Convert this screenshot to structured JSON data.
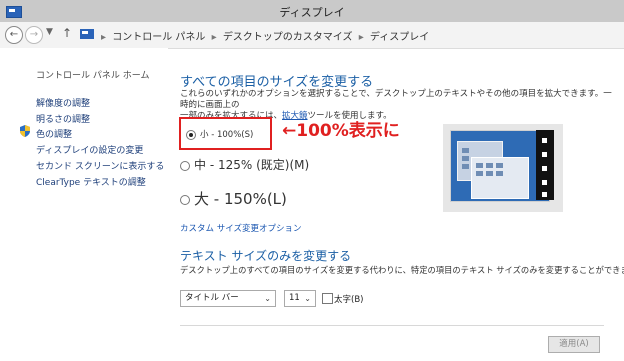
{
  "window": {
    "title": "ディスプレイ"
  },
  "nav": {
    "back_icon": "back-arrow-icon",
    "forward_icon": "forward-arrow-icon",
    "breadcrumb": [
      "コントロール パネル",
      "デスクトップのカスタマイズ",
      "ディスプレイ"
    ]
  },
  "sidebar": {
    "home": "コントロール パネル ホーム",
    "links": [
      "解像度の調整",
      "明るさの調整",
      "色の調整",
      "ディスプレイの設定の変更",
      "セカンド スクリーンに表示する",
      "ClearType テキストの調整"
    ]
  },
  "main": {
    "heading": "すべての項目のサイズを変更する",
    "desc_line1": "これらのいずれかのオプションを選択することで、デスクトップ上のテキストやその他の項目を拡大できます。一時的に画面上の",
    "desc_line2_before": "一部のみを拡大するには、",
    "desc_link": "拡大鏡",
    "desc_line2_after": "ツールを使用します。",
    "options": [
      {
        "label": "小 - 100%(S)",
        "checked": true
      },
      {
        "label": "中 - 125% (既定)(M)",
        "checked": false
      },
      {
        "label": "大 - 150%(L)",
        "checked": false
      }
    ],
    "annotation": "←100%表示に",
    "custom_link": "カスタム サイズ変更オプション",
    "text_heading": "テキスト サイズのみを変更する",
    "text_desc": "デスクトップ上のすべての項目のサイズを変更する代わりに、特定の項目のテキスト サイズのみを変更することができます。",
    "item_select": "タイトル バー",
    "size_select": "11",
    "bold_label": "太字(B)",
    "bold_checked": false,
    "apply_label": "適用(A)"
  },
  "colors": {
    "accent": "#1b5fa5",
    "annotation": "#e02020",
    "link": "#1a56b0"
  }
}
